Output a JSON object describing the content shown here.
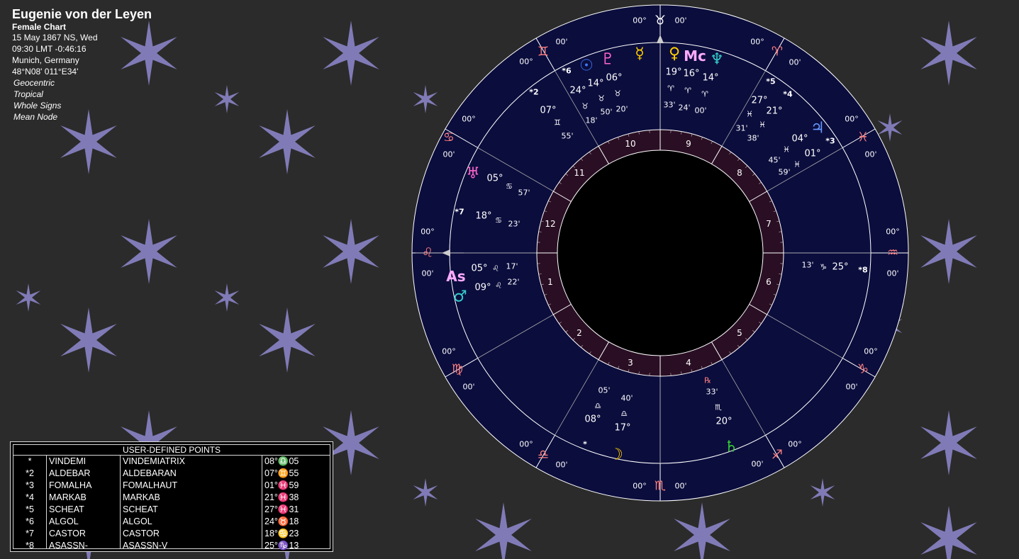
{
  "header": {
    "name": "Eugenie von der Leyen",
    "chart_kind": "Female Chart",
    "date": "15 May 1867 NS, Wed",
    "time": "09:30  LMT -0:46:16",
    "place": "Munich, Germany",
    "coords": "48°N08' 011°E34'",
    "options": [
      "Geocentric",
      "Tropical",
      "Whole Signs",
      "Mean Node"
    ]
  },
  "colors": {
    "background": "#2b2b2b",
    "wheel": "#0b0d3d",
    "inner_ring": "#2a0f24",
    "center": "#000000",
    "star": "#8a84c6"
  },
  "udp_table": {
    "title": "USER-DEFINED POINTS",
    "rows": [
      {
        "n": "*",
        "abbr": "VINDEMI",
        "name": "VINDEMIATRIX",
        "pos": "08°♎05"
      },
      {
        "n": "*2",
        "abbr": "ALDEBAR",
        "name": "ALDEBARAN",
        "pos": "07°♊55"
      },
      {
        "n": "*3",
        "abbr": "FOMALHA",
        "name": "FOMALHAUT",
        "pos": "01°♓59"
      },
      {
        "n": "*4",
        "abbr": "MARKAB",
        "name": "MARKAB",
        "pos": "21°♓38"
      },
      {
        "n": "*5",
        "abbr": "SCHEAT",
        "name": "SCHEAT",
        "pos": "27°♓31"
      },
      {
        "n": "*6",
        "abbr": "ALGOL",
        "name": "ALGOL",
        "pos": "24°♉18"
      },
      {
        "n": "*7",
        "abbr": "CASTOR",
        "name": "CASTOR",
        "pos": "18°♋23"
      },
      {
        "n": "*8",
        "abbr": "ASASSN-",
        "name": "ASASSN-V",
        "pos": "25°♑13"
      }
    ]
  },
  "wheel": {
    "houses": [
      "1",
      "2",
      "3",
      "4",
      "5",
      "6",
      "7",
      "8",
      "9",
      "10",
      "11",
      "12"
    ],
    "signs": [
      {
        "glyph": "♉",
        "icon": "taurus-icon",
        "color": "#ffffff",
        "a": "00°",
        "b": "00'"
      },
      {
        "glyph": "♈",
        "icon": "aries-icon",
        "color": "#ff8080",
        "a": "00°",
        "b": "00'"
      },
      {
        "glyph": "♓",
        "icon": "pisces-icon",
        "color": "#ff8080",
        "a": "00°",
        "b": "00'"
      },
      {
        "glyph": "♒",
        "icon": "aquarius-icon",
        "color": "#ff8080",
        "a": "00°",
        "b": "00'"
      },
      {
        "glyph": "♑",
        "icon": "capricorn-icon",
        "color": "#ff8080",
        "a": "00°",
        "b": "00'"
      },
      {
        "glyph": "♐",
        "icon": "sagittarius-icon",
        "color": "#ff8080",
        "a": "00°",
        "b": "00'"
      },
      {
        "glyph": "♏",
        "icon": "scorpio-icon",
        "color": "#ff8080",
        "a": "00°",
        "b": "00'"
      },
      {
        "glyph": "♎",
        "icon": "libra-icon",
        "color": "#ff8080",
        "a": "00°",
        "b": "00'"
      },
      {
        "glyph": "♍",
        "icon": "virgo-icon",
        "color": "#ff8080",
        "a": "00°",
        "b": "00'"
      },
      {
        "glyph": "♌",
        "icon": "leo-icon",
        "color": "#ff8080",
        "a": "00°",
        "b": "00'"
      },
      {
        "glyph": "♋",
        "icon": "cancer-icon",
        "color": "#ff8080",
        "a": "00°",
        "b": "00'"
      },
      {
        "glyph": "♊",
        "icon": "gemini-icon",
        "color": "#ff8080",
        "a": "00°",
        "b": "00'"
      }
    ],
    "bodies": [
      {
        "id": "sun",
        "glyph": "☉",
        "icon": "sun-icon",
        "color": "#3b7bff",
        "deg": "24°",
        "sign": "♉",
        "min": "18'"
      },
      {
        "id": "pluto",
        "glyph": "♇",
        "icon": "pluto-icon",
        "color": "#ff66cc",
        "deg": "14°",
        "sign": "♉",
        "min": "50'"
      },
      {
        "id": "mercury",
        "glyph": "☿",
        "icon": "mercury-icon",
        "color": "#ffcc00",
        "deg": "06°",
        "sign": "♉",
        "min": "20'"
      },
      {
        "id": "venus",
        "glyph": "♀",
        "icon": "venus-icon",
        "color": "#ffcc00",
        "deg": "19°",
        "sign": "♈",
        "min": "33'"
      },
      {
        "id": "mc",
        "glyph": "Mc",
        "icon": "midheaven-icon",
        "color": "#ffaaff",
        "deg": "16°",
        "sign": "♈",
        "min": "24'"
      },
      {
        "id": "neptune",
        "glyph": "♆",
        "icon": "neptune-icon",
        "color": "#33cccc",
        "deg": "14°",
        "sign": "♈",
        "min": "00'"
      },
      {
        "id": "jupiter",
        "glyph": "♃",
        "icon": "jupiter-icon",
        "color": "#6699ff",
        "deg": "04°",
        "sign": "♓",
        "min": "45'"
      },
      {
        "id": "uranus",
        "glyph": "♅",
        "icon": "uranus-icon",
        "color": "#ff66cc",
        "deg": "05°",
        "sign": "♋",
        "min": "57'"
      },
      {
        "id": "asc",
        "glyph": "As",
        "icon": "ascendant-icon",
        "color": "#ffaaff",
        "deg": "05°",
        "sign": "♌",
        "min": "17'"
      },
      {
        "id": "mars",
        "glyph": "♂",
        "icon": "mars-icon",
        "color": "#33cccc",
        "deg": "09°",
        "sign": "♌",
        "min": "22'"
      },
      {
        "id": "moon",
        "glyph": "☽",
        "icon": "moon-icon",
        "color": "#ffcc00",
        "deg": "17°",
        "sign": "♎",
        "min": "40'"
      },
      {
        "id": "saturn",
        "glyph": "♄",
        "icon": "saturn-icon",
        "color": "#33cc33",
        "deg": "20°",
        "sign": "♏",
        "min": "33'",
        "retro": "℞"
      }
    ],
    "fixed_stars": [
      {
        "label": "*6",
        "deg": "24°",
        "sign": "♉",
        "min": "18'"
      },
      {
        "label": "*2",
        "deg": "07°",
        "sign": "♊",
        "min": "55'"
      },
      {
        "label": "*5",
        "deg": "27°",
        "sign": "♓",
        "min": "31'"
      },
      {
        "label": "*4",
        "deg": "21°",
        "sign": "♓",
        "min": "38'"
      },
      {
        "label": "*3",
        "deg": "01°",
        "sign": "♓",
        "min": "59'"
      },
      {
        "label": "*7",
        "deg": "18°",
        "sign": "♋",
        "min": "23'"
      },
      {
        "label": "*8",
        "deg": "25°",
        "sign": "♑",
        "min": "13'"
      },
      {
        "label": "*",
        "deg": "08°",
        "sign": "♎",
        "min": "05'"
      }
    ]
  }
}
